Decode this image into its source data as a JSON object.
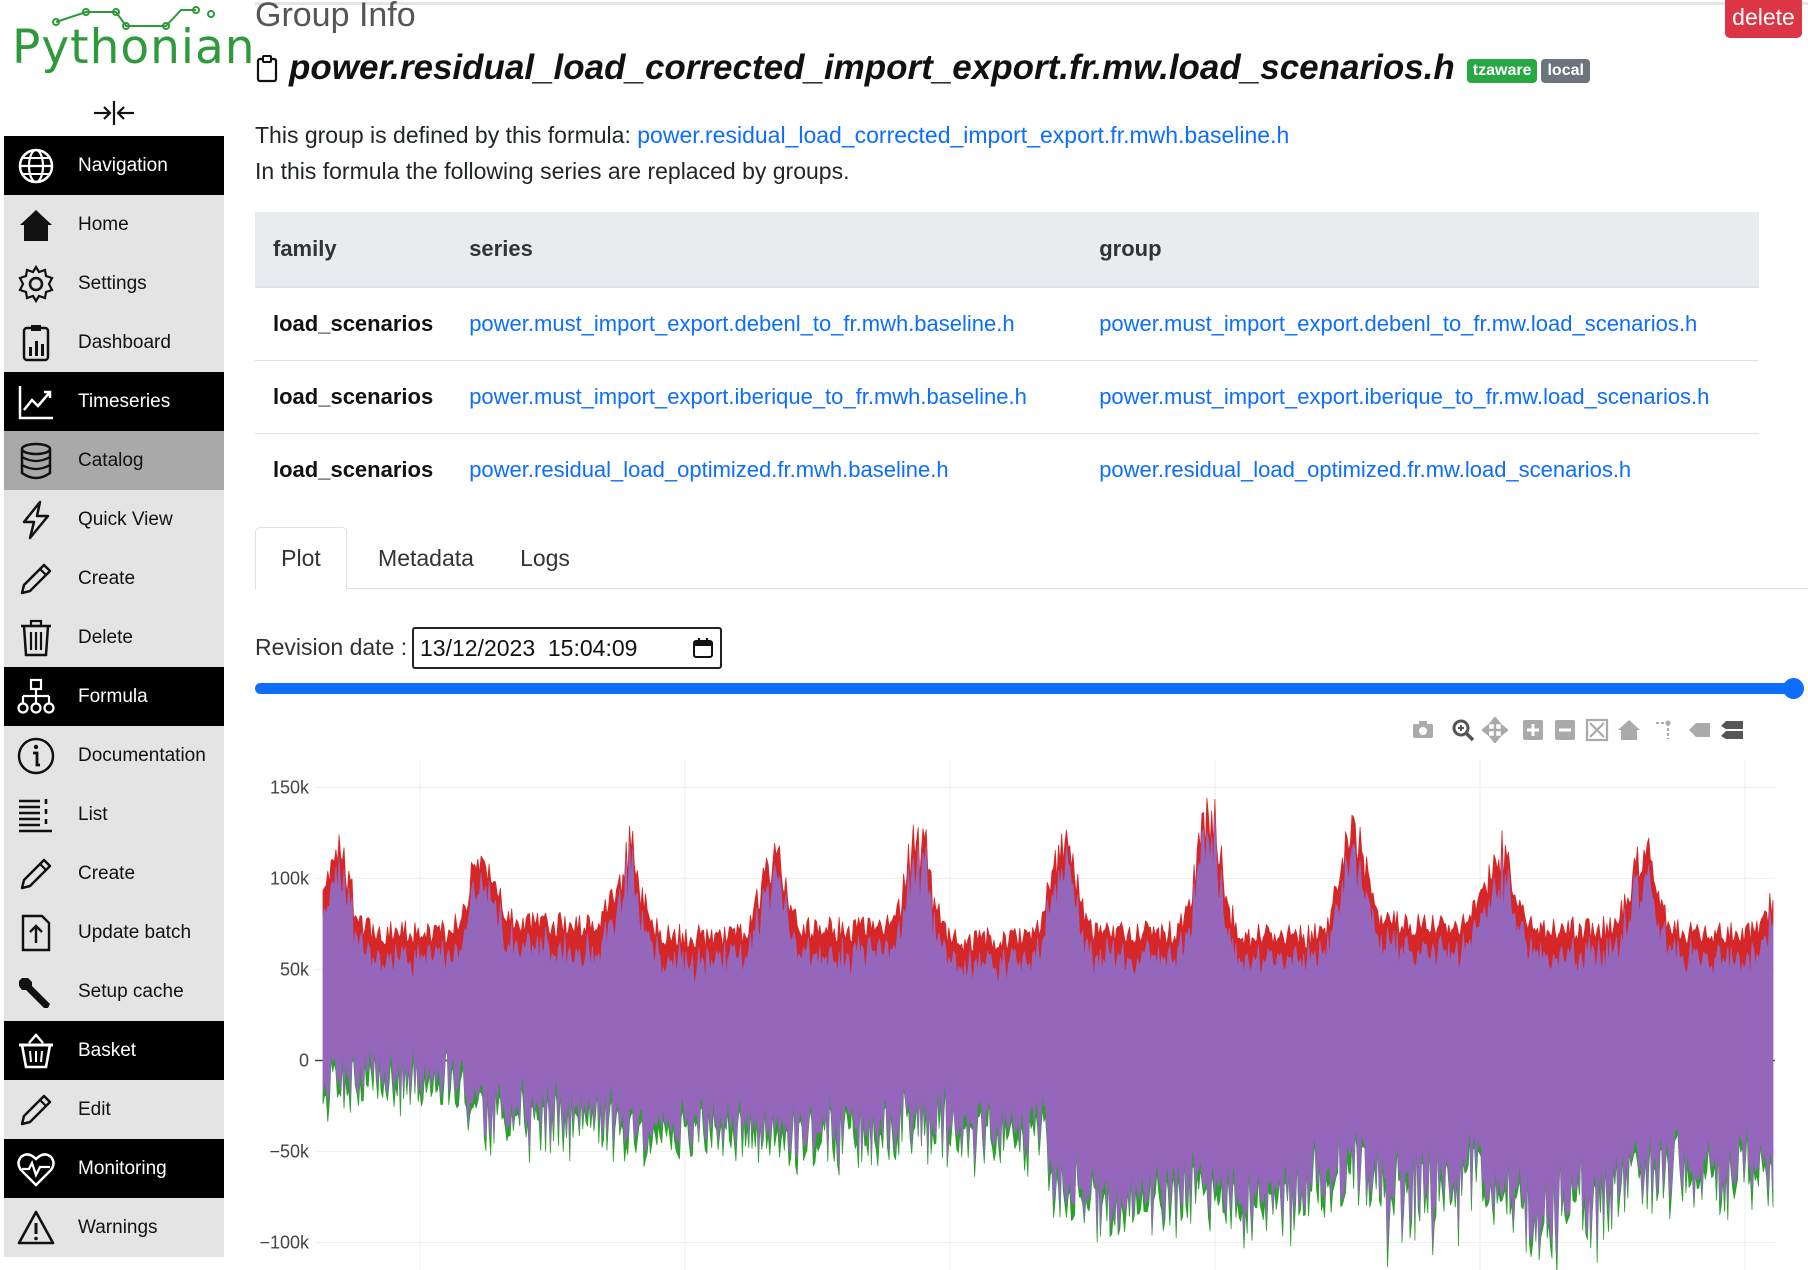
{
  "logo": {
    "text": "Pythonian"
  },
  "sidebar": {
    "items": [
      {
        "label": "Navigation",
        "icon": "globe-icon",
        "type": "section"
      },
      {
        "label": "Home",
        "icon": "home-icon",
        "type": "item"
      },
      {
        "label": "Settings",
        "icon": "gear-icon",
        "type": "item"
      },
      {
        "label": "Dashboard",
        "icon": "dashboard-icon",
        "type": "item"
      },
      {
        "label": "Timeseries",
        "icon": "chart-line-icon",
        "type": "section"
      },
      {
        "label": "Catalog",
        "icon": "database-icon",
        "type": "active"
      },
      {
        "label": "Quick View",
        "icon": "lightning-icon",
        "type": "item"
      },
      {
        "label": "Create",
        "icon": "pencil-icon",
        "type": "item"
      },
      {
        "label": "Delete",
        "icon": "trash-icon",
        "type": "item"
      },
      {
        "label": "Formula",
        "icon": "diagram-icon",
        "type": "section"
      },
      {
        "label": "Documentation",
        "icon": "info-icon",
        "type": "item"
      },
      {
        "label": "List",
        "icon": "list-icon",
        "type": "item"
      },
      {
        "label": "Create",
        "icon": "pencil-icon",
        "type": "item"
      },
      {
        "label": "Update batch",
        "icon": "upload-icon",
        "type": "item"
      },
      {
        "label": "Setup cache",
        "icon": "wrench-icon",
        "type": "item"
      },
      {
        "label": "Basket",
        "icon": "basket-icon",
        "type": "section"
      },
      {
        "label": "Edit",
        "icon": "pencil-icon",
        "type": "item"
      },
      {
        "label": "Monitoring",
        "icon": "heart-pulse-icon",
        "type": "section"
      },
      {
        "label": "Warnings",
        "icon": "warning-icon",
        "type": "item"
      }
    ]
  },
  "header": {
    "page_title": "Group Info",
    "delete_label": "delete",
    "group_name": "power.residual_load_corrected_import_export.fr.mw.load_scenarios.h",
    "badges": [
      "tzaware",
      "local"
    ]
  },
  "formula": {
    "intro": "This group is defined by this formula: ",
    "link": "power.residual_load_corrected_import_export.fr.mwh.baseline.h",
    "replaced_note": "In this formula the following series are replaced by groups."
  },
  "table": {
    "headers": [
      "family",
      "series",
      "group"
    ],
    "rows": [
      [
        "load_scenarios",
        "power.must_import_export.debenl_to_fr.mwh.baseline.h",
        "power.must_import_export.debenl_to_fr.mw.load_scenarios.h"
      ],
      [
        "load_scenarios",
        "power.must_import_export.iberique_to_fr.mwh.baseline.h",
        "power.must_import_export.iberique_to_fr.mw.load_scenarios.h"
      ],
      [
        "load_scenarios",
        "power.residual_load_optimized.fr.mwh.baseline.h",
        "power.residual_load_optimized.fr.mw.load_scenarios.h"
      ]
    ]
  },
  "tabs": [
    "Plot",
    "Metadata",
    "Logs"
  ],
  "revision": {
    "label": "Revision date :",
    "value": "13/12/2023  15:04:09",
    "slider_position": 1.0
  },
  "modebar": [
    "camera-icon",
    "zoom-icon",
    "pan-icon",
    "zoom-in-icon",
    "zoom-out-icon",
    "autoscale-icon",
    "reset-axes-icon",
    "spike-lines-icon",
    "hover-closest-icon",
    "hover-compare-icon"
  ],
  "colors": {
    "accent": "#0d6efd",
    "danger": "#dc3545",
    "series_red": "#d62728",
    "series_purple": "#9467bd",
    "series_green": "#2ca02c"
  },
  "chart_data": {
    "type": "line",
    "y_ticks": [
      "150k",
      "100k",
      "50k",
      "0",
      "−50k",
      "−100k"
    ],
    "y_tick_values": [
      150000,
      100000,
      50000,
      0,
      -50000,
      -100000
    ],
    "ylim": [
      -115000,
      165000
    ],
    "grid": true,
    "series_colors": [
      "#d62728",
      "#9467bd",
      "#2ca02c"
    ],
    "envelope": {
      "red_upper_base": [
        70000,
        75000,
        68000,
        72000,
        66000,
        70000,
        68000,
        75000,
        72000,
        70000
      ],
      "red_upper_peaks": [
        128000,
        120000,
        126000,
        125000,
        136000,
        135000,
        154000,
        138000,
        131000,
        126000
      ],
      "purple_lower_base": [
        -10000,
        -20000,
        -35000,
        -30000,
        -20000,
        -60000,
        -55000,
        -40000,
        -55000,
        -45000
      ],
      "purple_lower_troughs": [
        -2000,
        -35000,
        -30000,
        -45000,
        -50000,
        -90000,
        -85000,
        -95000,
        -100000,
        -75000
      ]
    }
  }
}
